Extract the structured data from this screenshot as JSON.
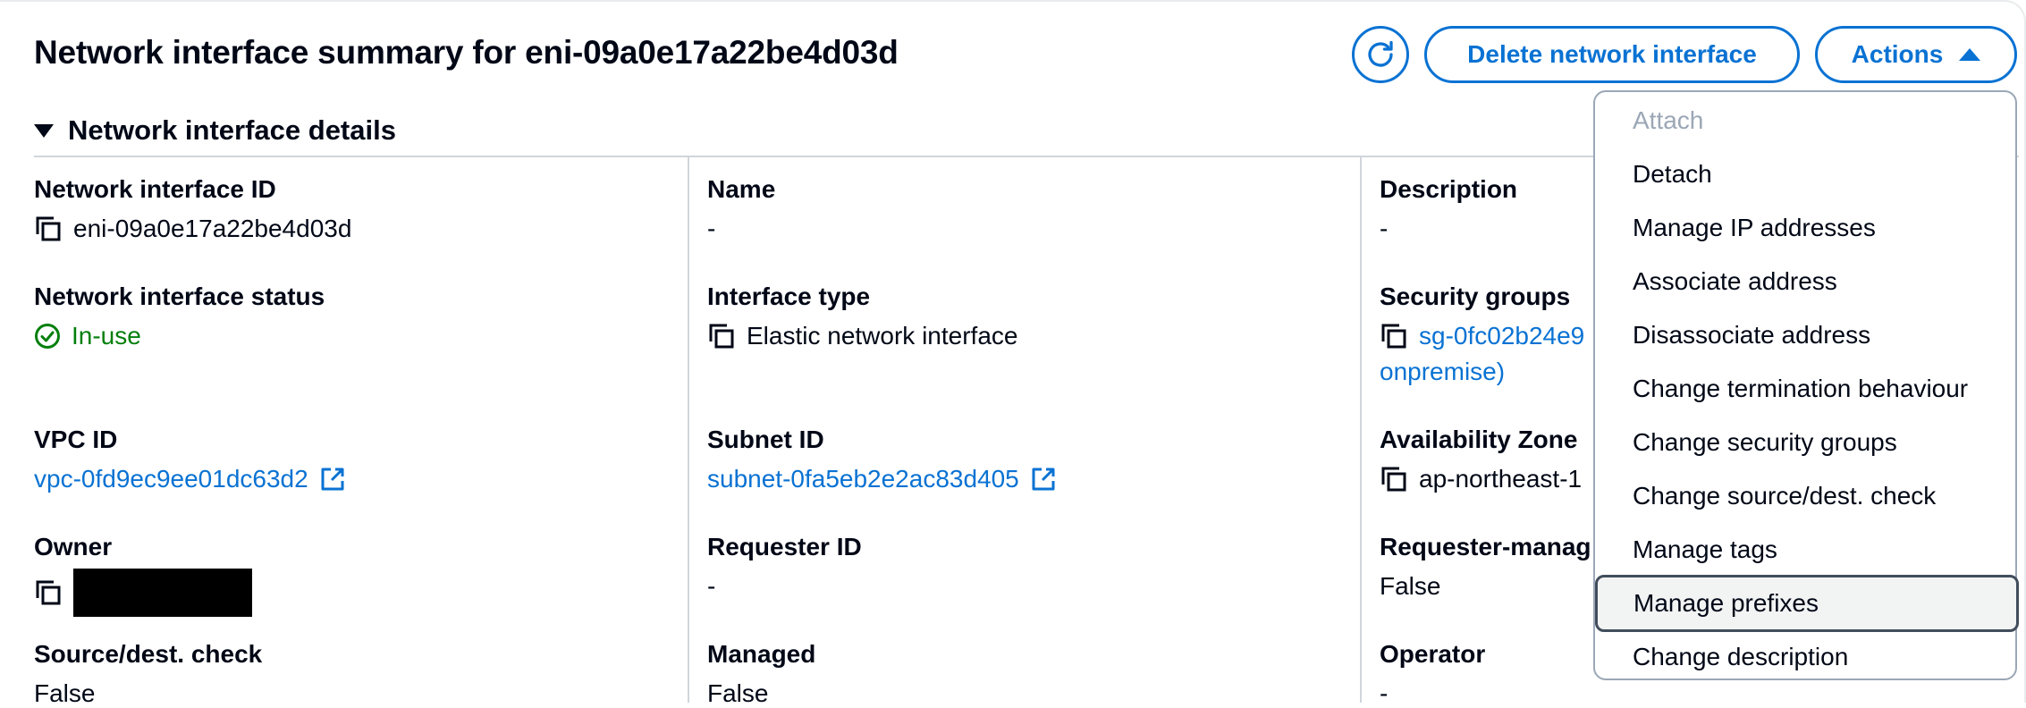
{
  "header": {
    "title": "Network interface summary for eni-09a0e17a22be4d03d",
    "delete_label": "Delete network interface",
    "actions_label": "Actions"
  },
  "section": {
    "title": "Network interface details"
  },
  "fields": {
    "eni_id": {
      "label": "Network interface ID",
      "value": "eni-09a0e17a22be4d03d"
    },
    "name": {
      "label": "Name",
      "value": "-"
    },
    "description": {
      "label": "Description",
      "value": "-"
    },
    "status": {
      "label": "Network interface status",
      "value": "In-use"
    },
    "interface_type": {
      "label": "Interface type",
      "value": "Elastic network interface"
    },
    "security_groups": {
      "label": "Security groups",
      "value_line1": "sg-0fc02b24e9",
      "value_line2": "onpremise)"
    },
    "vpc_id": {
      "label": "VPC ID",
      "value": "vpc-0fd9ec9ee01dc63d2"
    },
    "subnet_id": {
      "label": "Subnet ID",
      "value": "subnet-0fa5eb2e2ac83d405"
    },
    "availability_zone": {
      "label": "Availability Zone",
      "value": "ap-northeast-1"
    },
    "owner": {
      "label": "Owner",
      "value": ""
    },
    "requester_id": {
      "label": "Requester ID",
      "value": "-"
    },
    "requester_managed": {
      "label": "Requester-manag",
      "value": "False"
    },
    "source_dest_check": {
      "label": "Source/dest. check",
      "value": "False"
    },
    "managed": {
      "label": "Managed",
      "value": "False"
    },
    "operator": {
      "label": "Operator",
      "value": "-"
    }
  },
  "actions_menu": {
    "items": [
      {
        "label": "Attach",
        "disabled": true
      },
      {
        "label": "Detach"
      },
      {
        "label": "Manage IP addresses"
      },
      {
        "label": "Associate address"
      },
      {
        "label": "Disassociate address"
      },
      {
        "label": "Change termination behaviour"
      },
      {
        "label": "Change security groups"
      },
      {
        "label": "Change source/dest. check"
      },
      {
        "label": "Manage tags"
      },
      {
        "label": "Manage prefixes",
        "hovered": true
      },
      {
        "label": "Change description"
      }
    ]
  },
  "colors": {
    "link": "#0972d3",
    "success": "#037f0c",
    "text": "#000716",
    "disabled": "#9ba7b6"
  },
  "icons": {
    "refresh": "refresh-icon",
    "copy": "copy-icon",
    "external_link": "external-link-icon",
    "status_ok": "check-circle-icon",
    "caret": "caret-up-icon",
    "expand": "caret-down-icon"
  }
}
